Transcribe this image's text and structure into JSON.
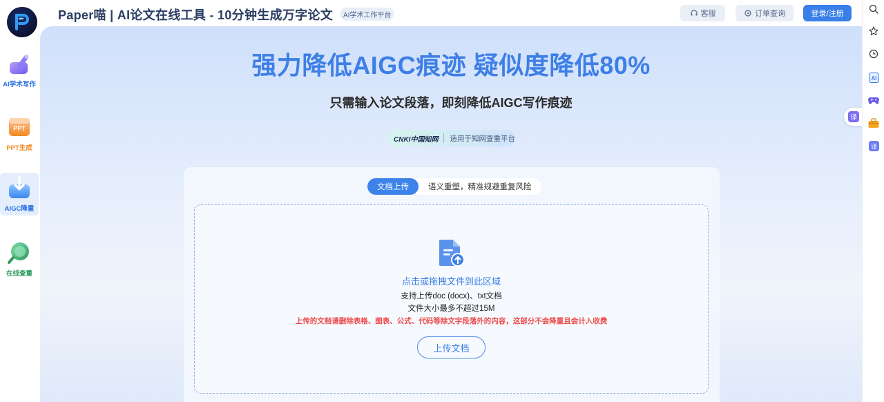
{
  "header": {
    "title": "Paper喵 | AI论文在线工具 - 10分钟生成万字论文",
    "tag": "AI学术工作平台",
    "service_label": "客服",
    "order_label": "订单查询",
    "login_label": "登录/注册"
  },
  "sidebar": {
    "items": [
      {
        "label": "AI学术写作",
        "icon": "pen-icon",
        "color": "#2b6fe3"
      },
      {
        "label": "PPT生成",
        "icon": "ppt-icon",
        "color": "#f08a24"
      },
      {
        "label": "AIGC降重",
        "icon": "download-icon",
        "color": "#2b6fe3"
      },
      {
        "label": "在线查重",
        "icon": "magnifier-icon",
        "color": "#2d9a5e"
      }
    ]
  },
  "hero": {
    "title": "强力降低AIGC痕迹 疑似度降低80%",
    "subtitle": "只需输入论文段落，即刻降低AIGC写作痕迹",
    "cnki_logo": "CNKI中国知网",
    "cnki_text": "适用于知网查重平台"
  },
  "tabs": [
    {
      "label": "文档上传",
      "active": true
    },
    {
      "label": "语义重塑，精准规避重复风险",
      "active": false
    }
  ],
  "upload": {
    "title": "点击或拖拽文件到此区域",
    "formats": "支持上传doc (docx)、txt文档",
    "size_limit": "文件大小最多不超过15M",
    "warning": "上传的文档请删除表格、图表、公式、代码等除文字段落外的内容，这部分不会降重且会计入收费",
    "button": "上传文档"
  },
  "right_rail": {
    "icons": [
      "search-icon",
      "star-icon",
      "history-icon",
      "ai-icon",
      "gamepad-icon",
      "toolbox-icon",
      "translate-icon"
    ],
    "float_label": "译",
    "translate_label": "译"
  },
  "colors": {
    "accent": "#3c80e8",
    "warning": "#ef4a4a",
    "title_blue": "#3d7fe6"
  }
}
